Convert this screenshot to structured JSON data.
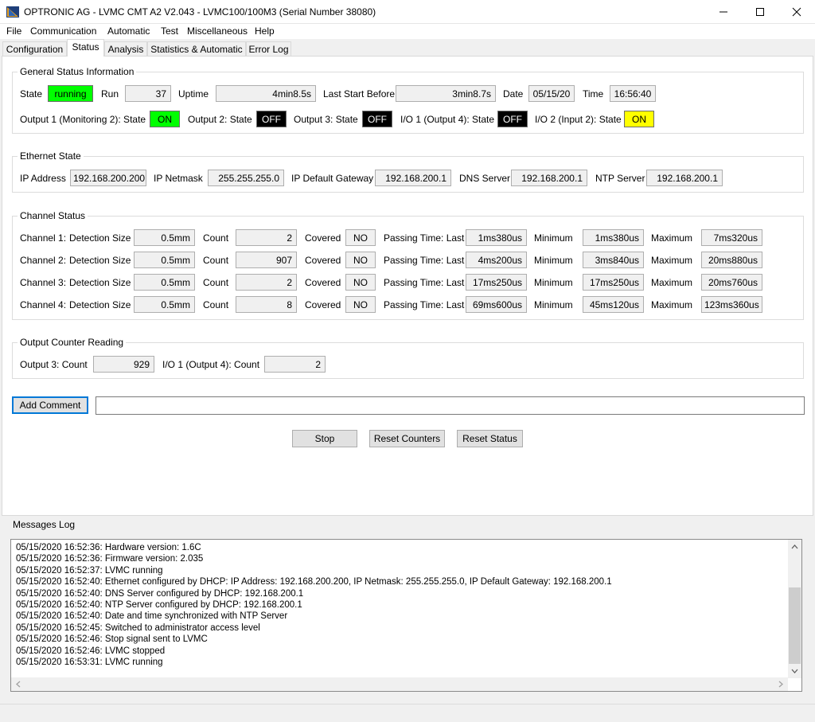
{
  "window": {
    "title": "OPTRONIC AG - LVMC CMT A2 V2.043 - LVMC100/100M3 (Serial Number 38080)"
  },
  "menu": [
    "File",
    "Communication",
    "Automatic",
    "Test",
    "Miscellaneous",
    "Help"
  ],
  "tabs": [
    "Configuration",
    "Status",
    "Analysis",
    "Statistics & Automatic",
    "Error Log"
  ],
  "active_tab": "Status",
  "general": {
    "title": "General Status Information",
    "state_label": "State",
    "state_value": "running",
    "run_label": "Run",
    "run_value": "37",
    "uptime_label": "Uptime",
    "uptime_value": "4min8.5s",
    "last_start_label": "Last Start Before",
    "last_start_value": "3min8.7s",
    "date_label": "Date",
    "date_value": "05/15/20",
    "time_label": "Time",
    "time_value": "16:56:40",
    "out1_label": "Output 1 (Monitoring 2): State",
    "out1_value": "ON",
    "out2_label": "Output 2: State",
    "out2_value": "OFF",
    "out3_label": "Output 3: State",
    "out3_value": "OFF",
    "io1_label": "I/O 1 (Output 4): State",
    "io1_value": "OFF",
    "io2_label": "I/O 2 (Input 2): State",
    "io2_value": "ON"
  },
  "ethernet": {
    "title": "Ethernet State",
    "ip_label": "IP Address",
    "ip_value": "192.168.200.200",
    "netmask_label": "IP Netmask",
    "netmask_value": "255.255.255.0",
    "gateway_label": "IP Default Gateway",
    "gateway_value": "192.168.200.1",
    "dns_label": "DNS Server",
    "dns_value": "192.168.200.1",
    "ntp_label": "NTP Server",
    "ntp_value": "192.168.200.1"
  },
  "channels": {
    "title": "Channel Status",
    "labels": {
      "detection": "Detection Size",
      "count": "Count",
      "covered": "Covered",
      "passing": "Passing Time: Last",
      "minimum": "Minimum",
      "maximum": "Maximum"
    },
    "rows": [
      {
        "name": "Channel 1:",
        "detection": "0.5mm",
        "count": "2",
        "covered": "NO",
        "last": "1ms380us",
        "min": "1ms380us",
        "max": "7ms320us"
      },
      {
        "name": "Channel 2:",
        "detection": "0.5mm",
        "count": "907",
        "covered": "NO",
        "last": "4ms200us",
        "min": "3ms840us",
        "max": "20ms880us"
      },
      {
        "name": "Channel 3:",
        "detection": "0.5mm",
        "count": "2",
        "covered": "NO",
        "last": "17ms250us",
        "min": "17ms250us",
        "max": "20ms760us"
      },
      {
        "name": "Channel 4:",
        "detection": "0.5mm",
        "count": "8",
        "covered": "NO",
        "last": "69ms600us",
        "min": "45ms120us",
        "max": "123ms360us"
      }
    ]
  },
  "output_counter": {
    "title": "Output Counter Reading",
    "out3_label": "Output 3: Count",
    "out3_value": "929",
    "io1_label": "I/O 1 (Output 4): Count",
    "io1_value": "2"
  },
  "actions": {
    "add_comment": "Add Comment",
    "comment_value": "",
    "stop": "Stop",
    "reset_counters": "Reset Counters",
    "reset_status": "Reset Status"
  },
  "messages": {
    "title": "Messages Log",
    "lines": [
      "05/15/2020 16:52:36: Hardware version: 1.6C",
      "05/15/2020 16:52:36: Firmware version: 2.035",
      "05/15/2020 16:52:37: LVMC running",
      "05/15/2020 16:52:40: Ethernet configured by DHCP: IP Address: 192.168.200.200, IP Netmask: 255.255.255.0, IP Default Gateway: 192.168.200.1",
      "05/15/2020 16:52:40: DNS Server configured by DHCP: 192.168.200.1",
      "05/15/2020 16:52:40: NTP Server configured by DHCP: 192.168.200.1",
      "05/15/2020 16:52:40: Date and time synchronized with NTP Server",
      "05/15/2020 16:52:45: Switched to administrator access level",
      "05/15/2020 16:52:46: Stop signal sent to LVMC",
      "05/15/2020 16:52:46: LVMC stopped",
      "05/15/2020 16:53:31: LVMC running"
    ]
  },
  "colors": {
    "green": "#00ff00",
    "black": "#000000",
    "yellow": "#ffff00",
    "focus_blue": "#0078d7"
  }
}
